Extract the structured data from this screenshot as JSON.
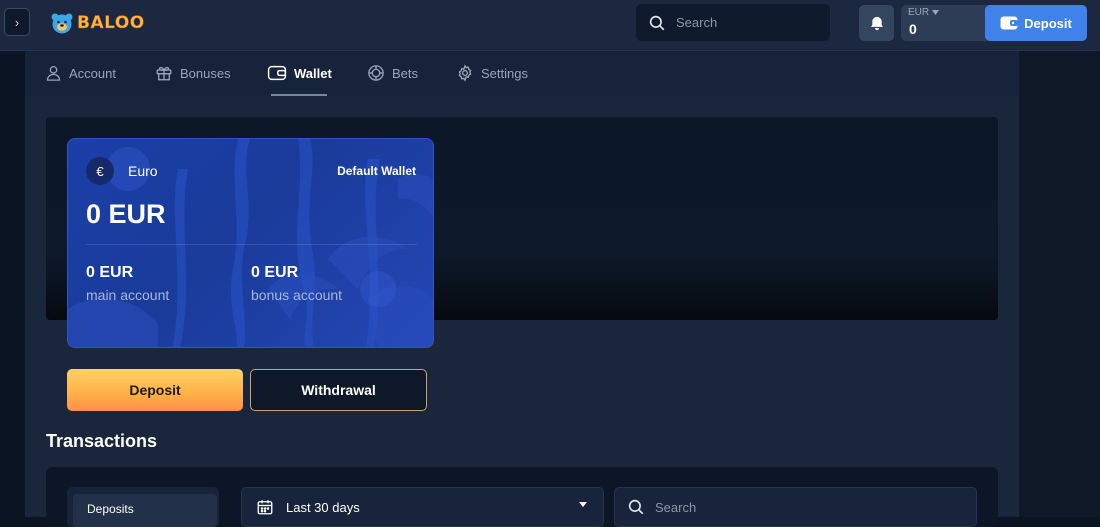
{
  "brand": {
    "name": "BALOO",
    "logo_icon": "bear-icon"
  },
  "header": {
    "search_placeholder": "Search",
    "currency": "EUR",
    "balance": "0",
    "deposit_label": "Deposit"
  },
  "nav": {
    "tabs": [
      {
        "label": "Account",
        "icon": "user-icon"
      },
      {
        "label": "Bonuses",
        "icon": "gift-icon"
      },
      {
        "label": "Wallet",
        "icon": "wallet-icon",
        "active": true
      },
      {
        "label": "Bets",
        "icon": "chip-icon"
      },
      {
        "label": "Settings",
        "icon": "gear-icon"
      }
    ]
  },
  "wallet_card": {
    "currency_symbol": "€",
    "currency_name": "Euro",
    "default_label": "Default Wallet",
    "total": "0 EUR",
    "main_value": "0 EUR",
    "main_label": "main account",
    "bonus_value": "0 EUR",
    "bonus_label": "bonus account"
  },
  "actions": {
    "deposit": "Deposit",
    "withdrawal": "Withdrawal"
  },
  "transactions": {
    "title": "Transactions",
    "type_selected": "Deposits",
    "period_selected": "Last 30 days",
    "search_placeholder": "Search"
  },
  "colors": {
    "accent_blue": "#3f82ea",
    "deposit_gradient_top": "#ffd166",
    "deposit_gradient_bottom": "#ff8f4a",
    "card_blue": "#1b3fa8"
  }
}
